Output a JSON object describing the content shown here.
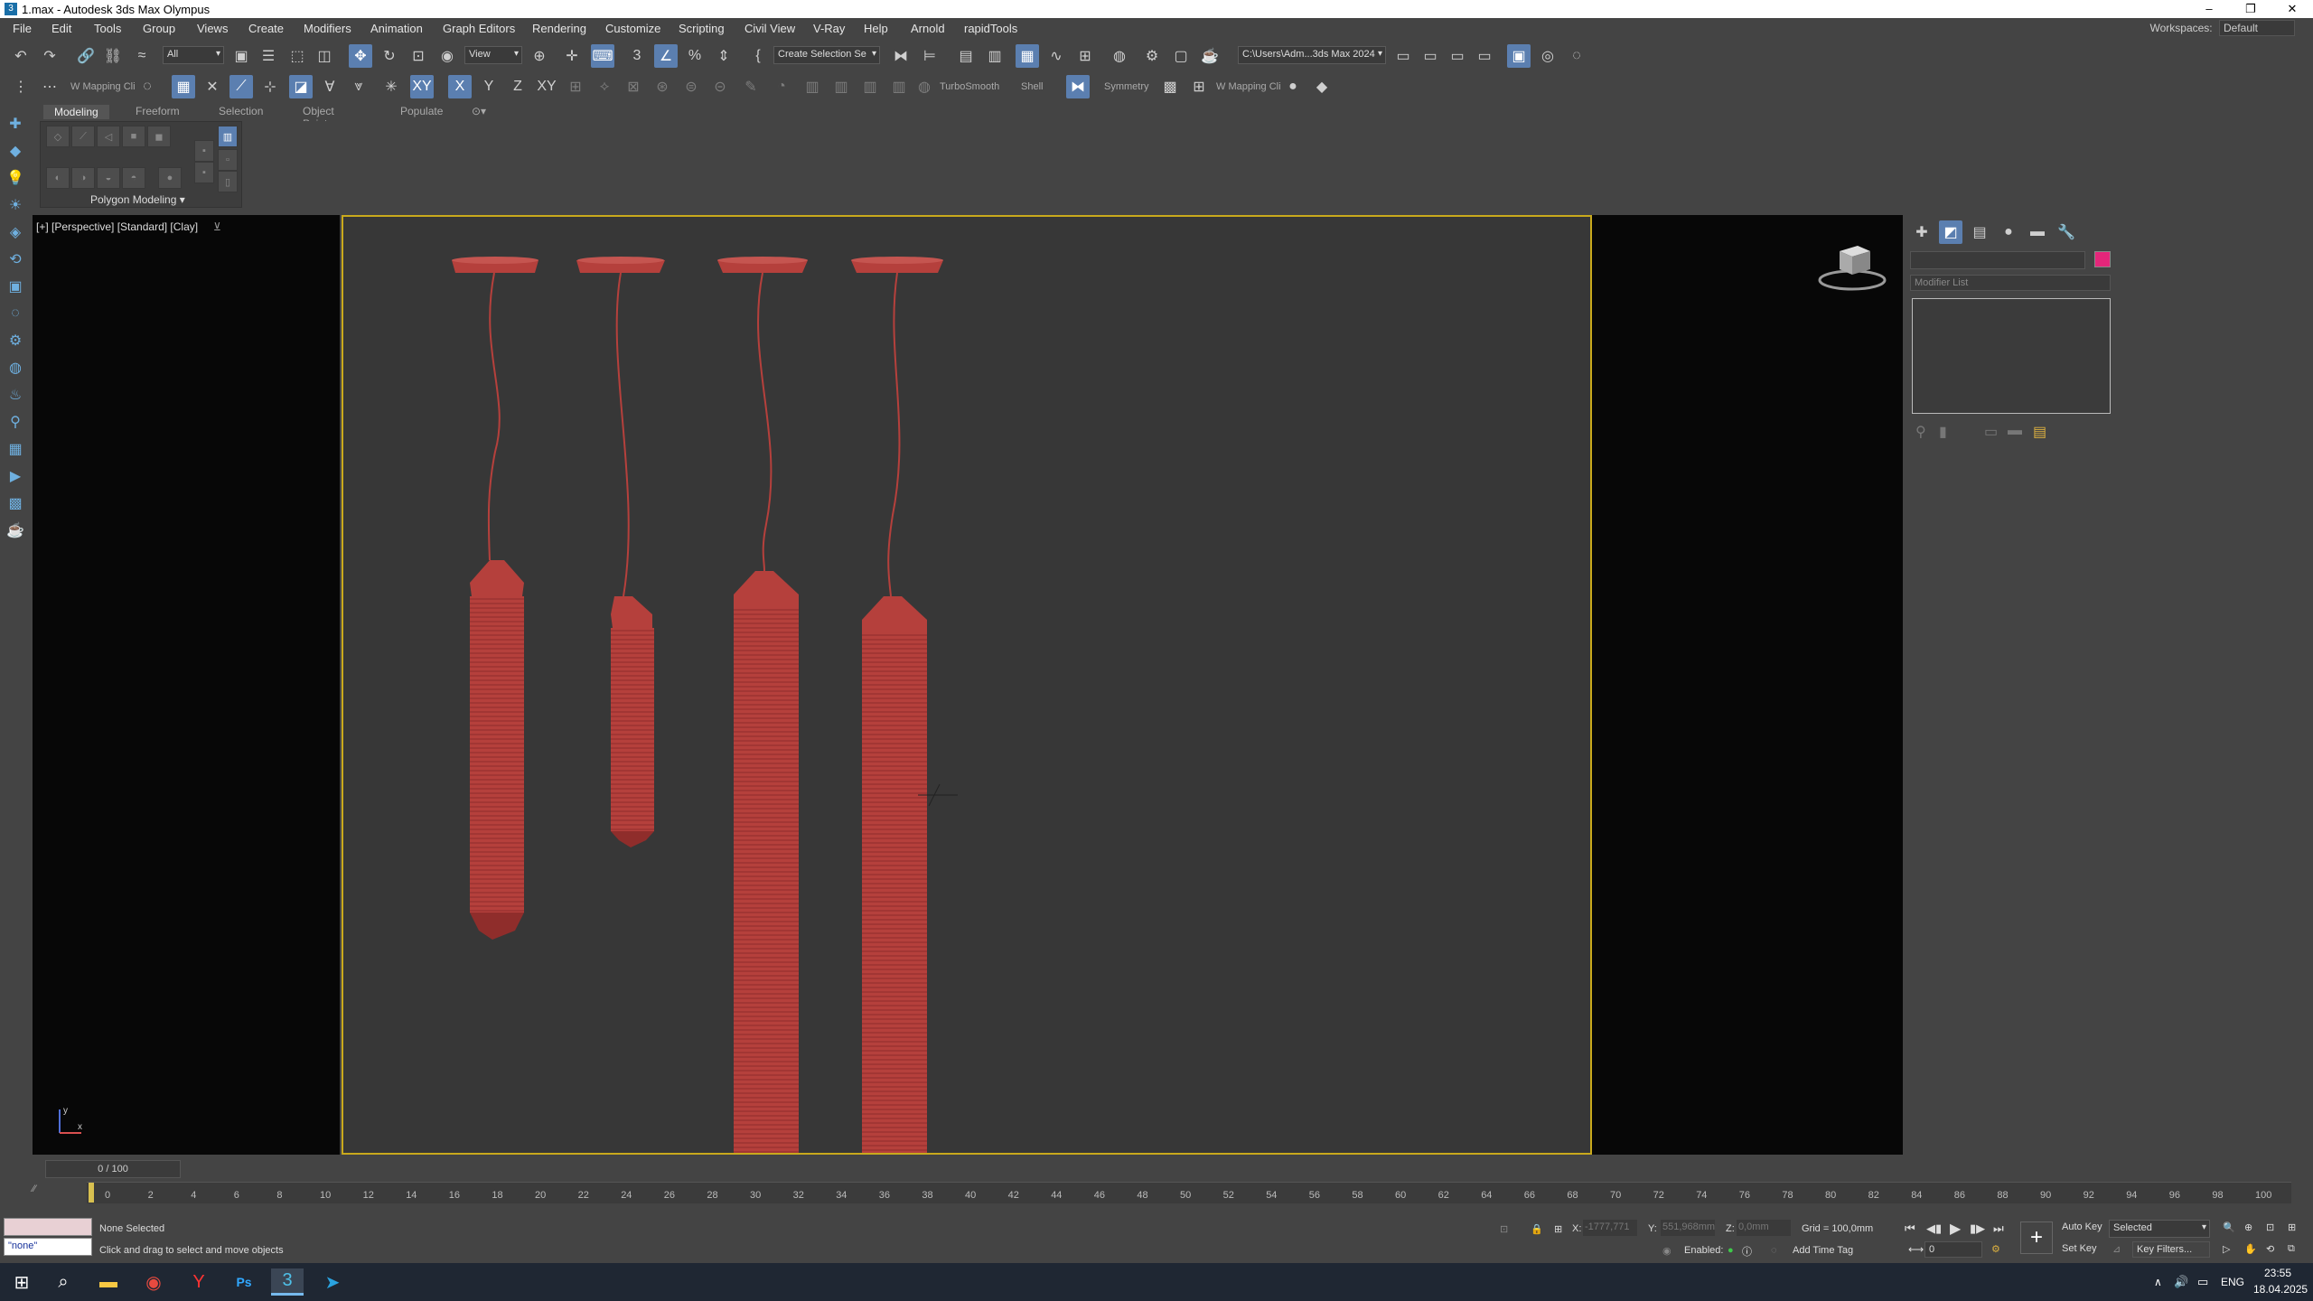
{
  "window": {
    "title": "1.max - Autodesk 3ds Max Olympus",
    "minimize": "–",
    "restore": "❐",
    "close": "✕"
  },
  "menu": [
    "File",
    "Edit",
    "Tools",
    "Group",
    "Views",
    "Create",
    "Modifiers",
    "Animation",
    "Graph Editors",
    "Rendering",
    "Customize",
    "Scripting",
    "Civil View",
    "V-Ray",
    "Help",
    "Arnold",
    "rapidTools"
  ],
  "workspaces": {
    "label": "Workspaces:",
    "value": "Default"
  },
  "toolbar1": {
    "selection_filter": "All",
    "ref_coord": "View",
    "named_selection": "Create Selection Se",
    "path": "C:\\Users\\Adm...3ds Max 2024"
  },
  "toolbar2": {
    "mapping1": "W Mapping Cli",
    "turbosmooth": "TurboSmooth",
    "shell": "Shell",
    "symmetry": "Symmetry",
    "mapping2": "W Mapping Cli",
    "axis_x": "X",
    "axis_y": "Y",
    "axis_z": "Z",
    "axis_xy": "XY",
    "axis_xy2": "XY"
  },
  "ribbon": {
    "tabs": [
      "Modeling",
      "Freeform",
      "Selection",
      "Object Paint",
      "Populate"
    ],
    "active_tab": "Modeling",
    "panel_label": "Polygon Modeling ▾"
  },
  "viewport": {
    "label": "[+] [Perspective] [Standard] [Clay]",
    "object_color": "#b5403c",
    "axis_label_y": "y",
    "axis_label_x": "x"
  },
  "command_panel": {
    "modifier_list": "Modifier List"
  },
  "time": {
    "slider": "0 / 100",
    "ticks": [
      "0",
      "2",
      "4",
      "6",
      "8",
      "10",
      "12",
      "14",
      "16",
      "18",
      "20",
      "22",
      "24",
      "26",
      "28",
      "30",
      "32",
      "34",
      "36",
      "38",
      "40",
      "42",
      "44",
      "46",
      "48",
      "50",
      "52",
      "54",
      "56",
      "58",
      "60",
      "62",
      "64",
      "66",
      "68",
      "70",
      "72",
      "74",
      "76",
      "78",
      "80",
      "82",
      "84",
      "86",
      "88",
      "90",
      "92",
      "94",
      "96",
      "98",
      "100"
    ]
  },
  "status": {
    "maxscript": "\"none\"",
    "selected": "None Selected",
    "prompt": "Click and drag to select and move objects",
    "x_label": "X:",
    "x": "-1777,771",
    "y_label": "Y:",
    "y": "551,968mm",
    "z_label": "Z:",
    "z": "0,0mm",
    "grid": "Grid = 100,0mm",
    "enabled": "Enabled:",
    "add_time_tag": "Add Time Tag",
    "auto_key": "Auto Key",
    "set_key": "Set Key",
    "selected_dd": "Selected",
    "key_filters": "Key Filters...",
    "frame": "0"
  },
  "taskbar": {
    "lang": "ENG",
    "time": "23:55",
    "date": "18.04.2025",
    "ps": "Ps"
  }
}
